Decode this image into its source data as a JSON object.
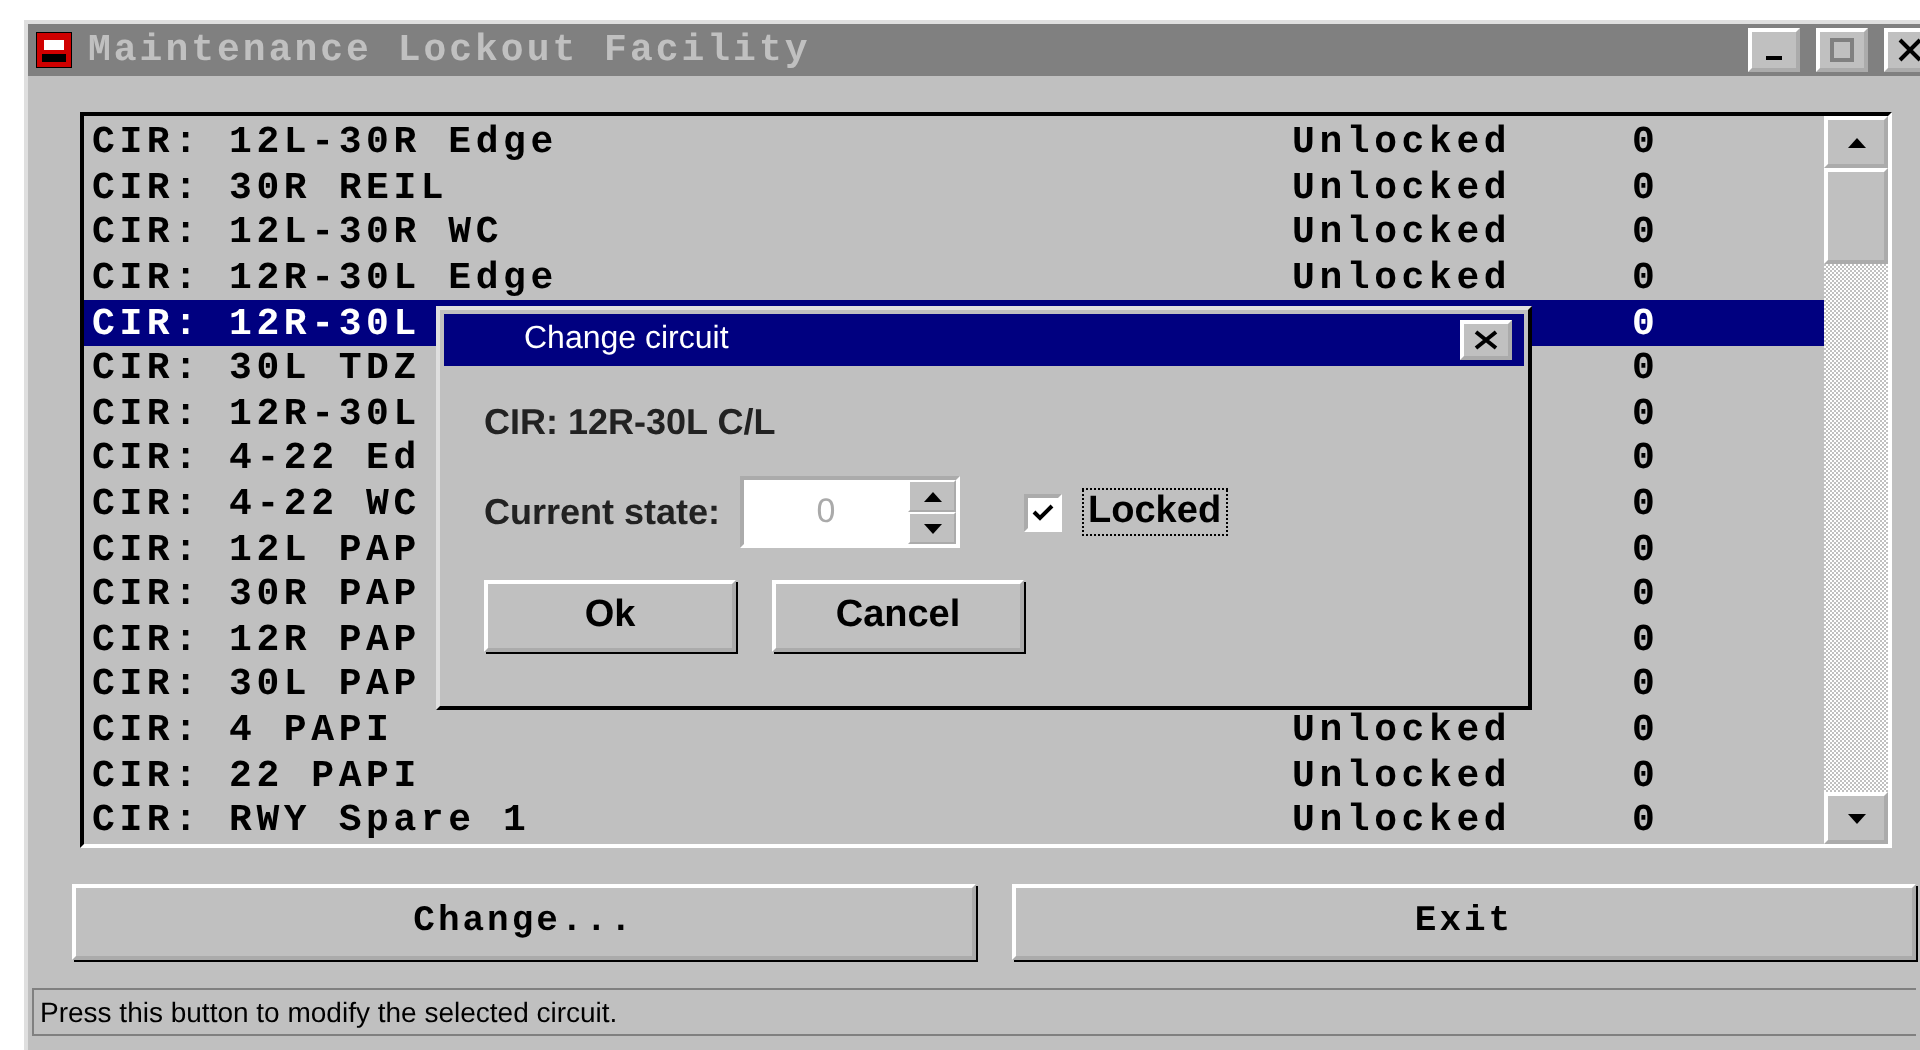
{
  "window": {
    "title": "Maintenance Lockout Facility"
  },
  "list": {
    "rows": [
      {
        "name": "CIR: 12L-30R Edge",
        "status": "Unlocked",
        "value": "0",
        "selected": false
      },
      {
        "name": "CIR: 30R REIL",
        "status": "Unlocked",
        "value": "0",
        "selected": false
      },
      {
        "name": "CIR: 12L-30R WC",
        "status": "Unlocked",
        "value": "0",
        "selected": false
      },
      {
        "name": "CIR: 12R-30L Edge",
        "status": "Unlocked",
        "value": "0",
        "selected": false
      },
      {
        "name": "CIR: 12R-30L",
        "value": "0",
        "selected": true
      },
      {
        "name": "CIR: 30L TDZ",
        "value": "0",
        "selected": false
      },
      {
        "name": "CIR: 12R-30L",
        "value": "0",
        "selected": false
      },
      {
        "name": "CIR: 4-22 Ed",
        "value": "0",
        "selected": false
      },
      {
        "name": "CIR: 4-22 WC",
        "value": "0",
        "selected": false
      },
      {
        "name": "CIR: 12L PAP",
        "value": "0",
        "selected": false
      },
      {
        "name": "CIR: 30R PAP",
        "value": "0",
        "selected": false
      },
      {
        "name": "CIR: 12R PAP",
        "value": "0",
        "selected": false
      },
      {
        "name": "CIR: 30L PAP",
        "value": "0",
        "selected": false
      },
      {
        "name": "CIR: 4 PAPI",
        "status": "Unlocked",
        "value": "0",
        "selected": false
      },
      {
        "name": "CIR: 22 PAPI",
        "status": "Unlocked",
        "value": "0",
        "selected": false
      },
      {
        "name": "CIR: RWY Spare 1",
        "status": "Unlocked",
        "value": "0",
        "selected": false
      }
    ]
  },
  "buttons": [
    "Change...",
    "Exit"
  ],
  "status_bar": "Press this button to modify the selected circuit.",
  "dialog": {
    "title": "Change circuit",
    "circuit": "CIR: 12R-30L C/L",
    "state_label": "Current state:",
    "state_value": "0",
    "locked": {
      "label": "Locked",
      "checked": true
    },
    "buttons": [
      "Ok",
      "Cancel"
    ]
  }
}
